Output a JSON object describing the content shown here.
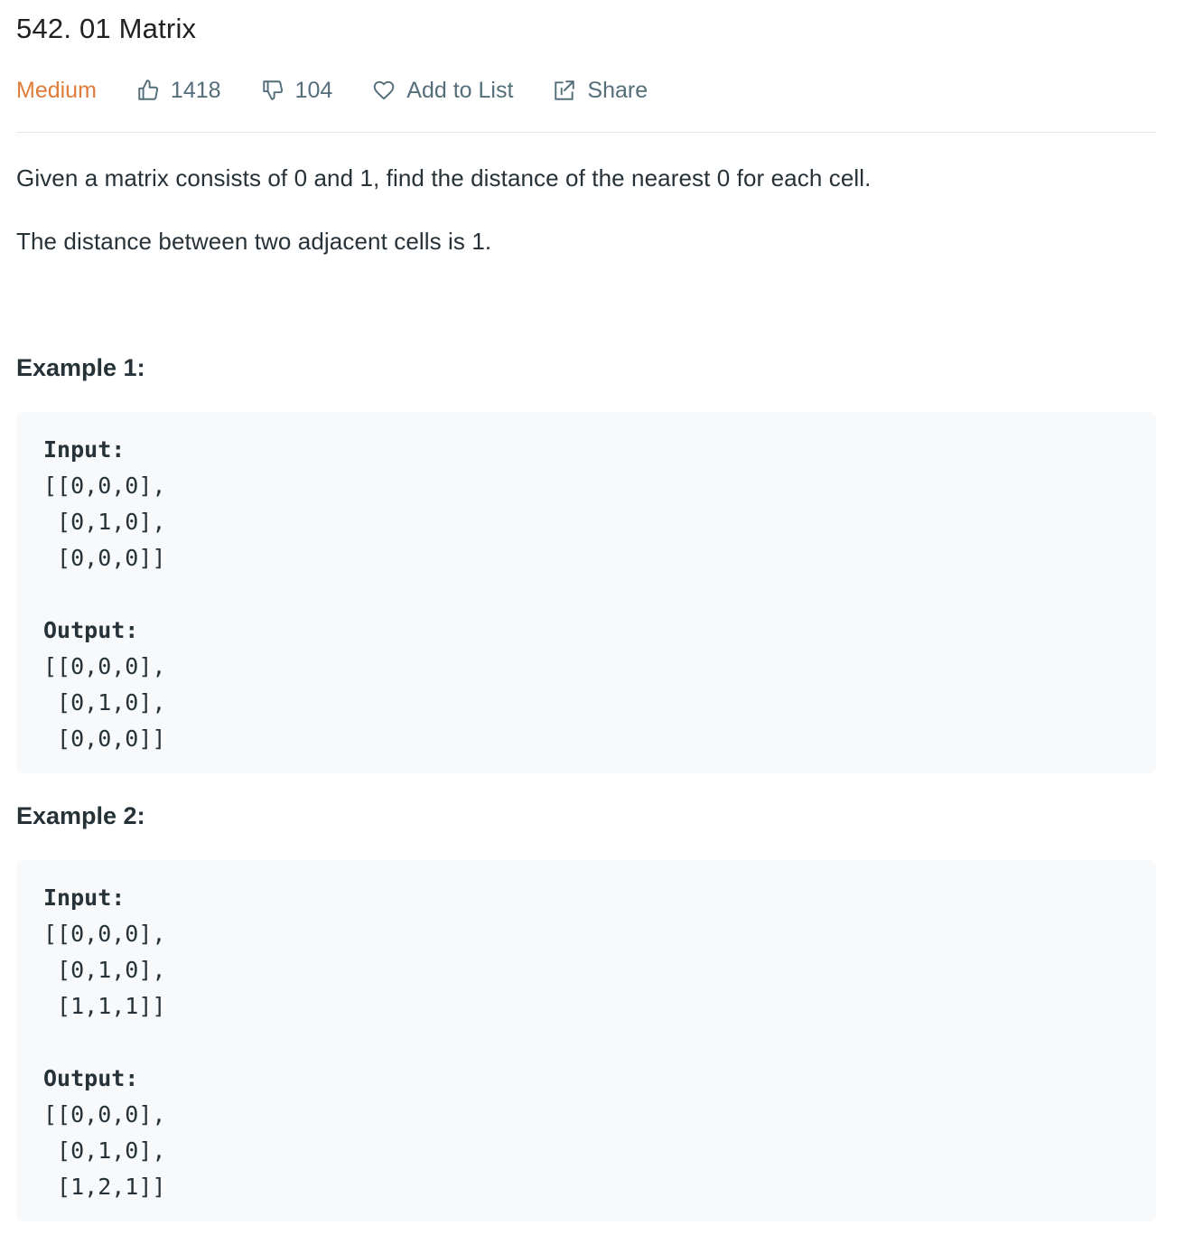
{
  "problem": {
    "title": "542. 01 Matrix",
    "difficulty": "Medium",
    "likes": "1418",
    "dislikes": "104",
    "add_to_list": "Add to List",
    "share": "Share",
    "description": [
      "Given a matrix consists of 0 and 1, find the distance of the nearest 0 for each cell.",
      "The distance between two adjacent cells is 1."
    ]
  },
  "colors": {
    "difficulty": "#e07b39",
    "meta_text": "#546e7a",
    "code_bg": "#f7f9fa"
  },
  "examples": [
    {
      "title": "Example 1:",
      "input_label": "Input:",
      "input_lines": [
        "[[0,0,0],",
        " [0,1,0],",
        " [0,0,0]]"
      ],
      "output_label": "Output:",
      "output_lines": [
        "[[0,0,0],",
        " [0,1,0],",
        " [0,0,0]]"
      ]
    },
    {
      "title": "Example 2:",
      "input_label": "Input:",
      "input_lines": [
        "[[0,0,0],",
        " [0,1,0],",
        " [1,1,1]]"
      ],
      "output_label": "Output:",
      "output_lines": [
        "[[0,0,0],",
        " [0,1,0],",
        " [1,2,1]]"
      ]
    }
  ]
}
